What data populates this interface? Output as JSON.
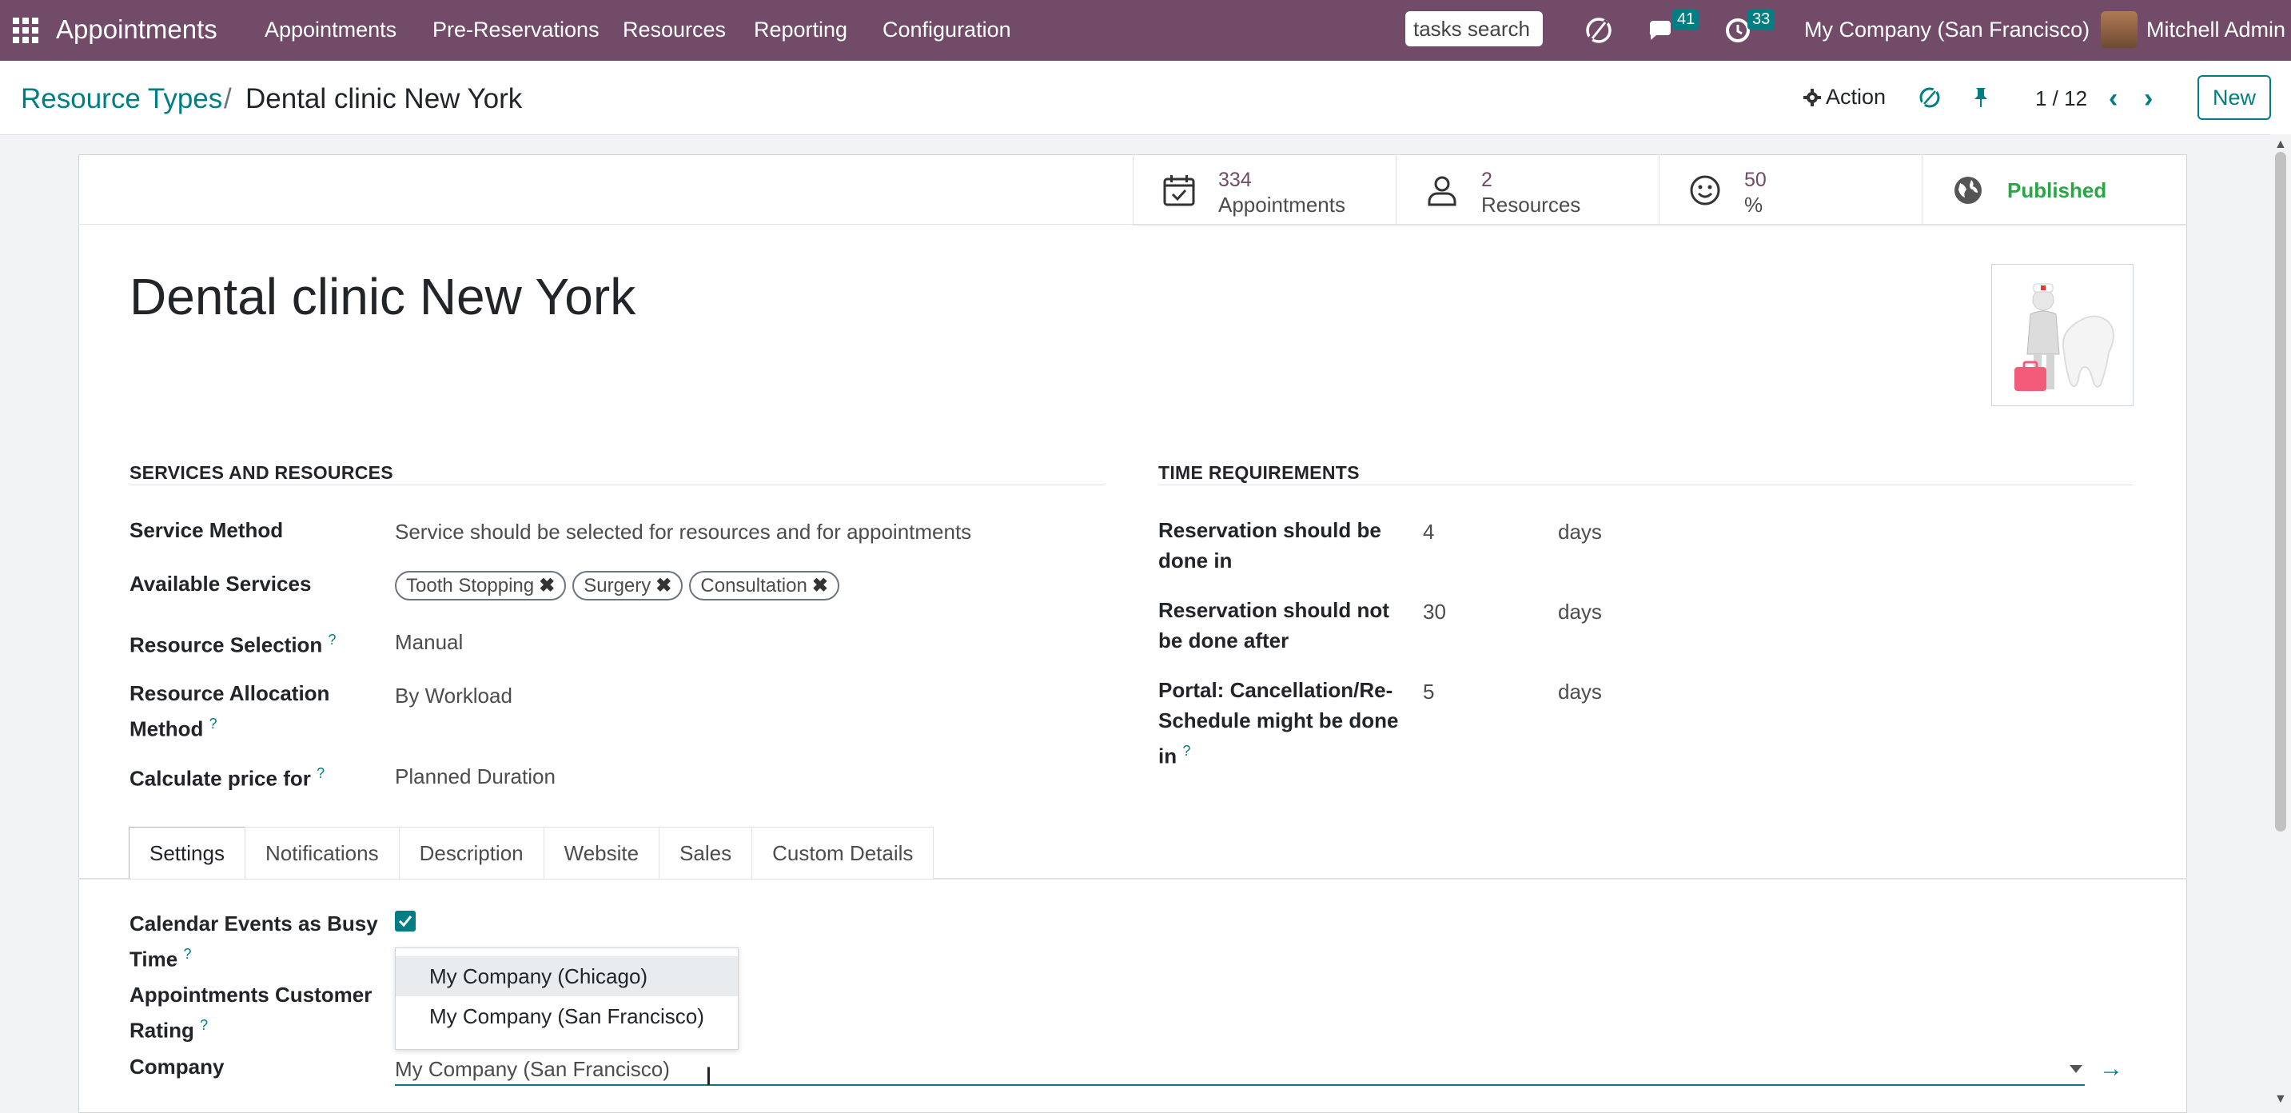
{
  "navbar": {
    "brand": "Appointments",
    "menu": [
      "Appointments",
      "Pre-Reservations",
      "Resources",
      "Reporting",
      "Configuration"
    ],
    "search_value": "tasks search",
    "messages_count": "41",
    "activities_count": "33",
    "company": "My Company (San Francisco)",
    "user": "Mitchell Admin"
  },
  "control_panel": {
    "breadcrumb_parent": "Resource Types",
    "breadcrumb_separator": "/",
    "breadcrumb_current": "Dental clinic New York",
    "action_label": "Action",
    "pager": "1 / 12",
    "new_label": "New"
  },
  "stats": {
    "appointments_value": "334",
    "appointments_label": "Appointments",
    "resources_value": "2",
    "resources_label": "Resources",
    "rating_value": "50",
    "rating_label": "%",
    "published_label": "Published"
  },
  "record": {
    "title": "Dental clinic New York"
  },
  "services": {
    "section_title": "SERVICES AND RESOURCES",
    "service_method_label": "Service Method",
    "service_method_value": "Service should be selected for resources and for appointments",
    "available_services_label": "Available Services",
    "available_services": [
      "Tooth Stopping",
      "Surgery",
      "Consultation"
    ],
    "resource_selection_label": "Resource Selection",
    "resource_selection_value": "Manual",
    "allocation_label_1": "Resource Allocation",
    "allocation_label_2": "Method",
    "allocation_value": "By Workload",
    "price_label": "Calculate price for",
    "price_value": "Planned Duration"
  },
  "time": {
    "section_title": "TIME REQUIREMENTS",
    "row1_label_1": "Reservation should be",
    "row1_label_2": "done in",
    "row1_value": "4",
    "row1_unit": "days",
    "row2_label_1": "Reservation should not",
    "row2_label_2": "be done after",
    "row2_value": "30",
    "row2_unit": "days",
    "row3_label_1": "Portal: Cancellation/Re-",
    "row3_label_2": "Schedule might be done",
    "row3_label_3": "in",
    "row3_value": "5",
    "row3_unit": "days"
  },
  "tabs": [
    "Settings",
    "Notifications",
    "Description",
    "Website",
    "Sales",
    "Custom Details"
  ],
  "settings": {
    "busy_label_1": "Calendar Events as Busy",
    "busy_label_2": "Time",
    "busy_checked": true,
    "rating_label_1": "Appointments Customer",
    "rating_label_2": "Rating",
    "company_label": "Company",
    "company_value": "My Company (San Francisco)",
    "dropdown_options": [
      "My Company (Chicago)",
      "My Company (San Francisco)"
    ]
  },
  "help_mark": "?",
  "colors": {
    "navbar": "#714b67",
    "accent": "#017e84",
    "published": "#28a745"
  }
}
